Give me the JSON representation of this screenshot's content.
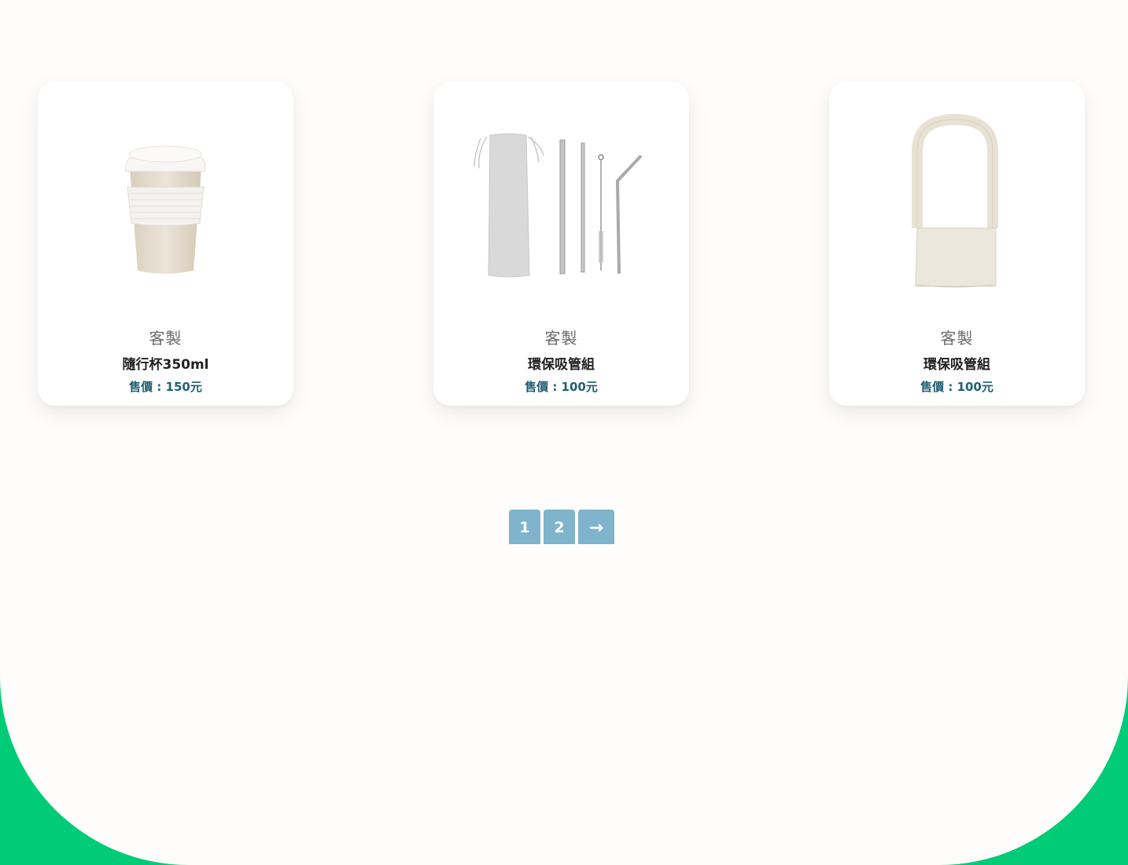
{
  "products": [
    {
      "category": "客製",
      "name": "隨行杯350ml",
      "price": "售價 : 150元",
      "image": "cup-image"
    },
    {
      "category": "客製",
      "name": "環保吸管組",
      "price": "售價 : 100元",
      "image": "straw-set-image"
    },
    {
      "category": "客製",
      "name": "環保吸管組",
      "price": "售價 : 100元",
      "image": "cup-sleeve-bag-image"
    }
  ],
  "pagination": {
    "pages": [
      "1",
      "2"
    ],
    "current": "1",
    "next_icon": "→"
  },
  "colors": {
    "background": "#fffdfb",
    "accent_green": "#00cc77",
    "pager": "#7fb4cc",
    "price": "#1f5f72"
  }
}
